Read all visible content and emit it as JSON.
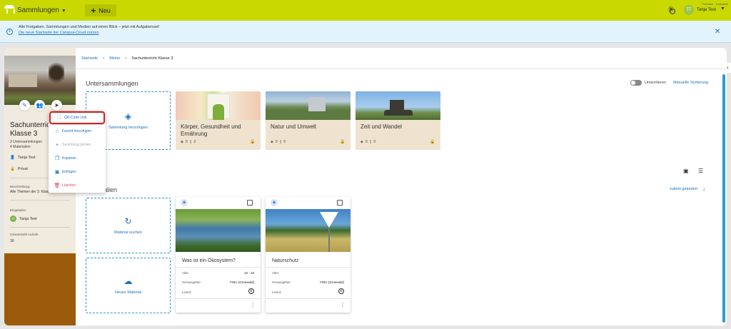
{
  "topbar": {
    "app_title": "Sammlungen",
    "new_label": "Neu",
    "user_org": "Premium · Demofeld",
    "user_initials": "TT",
    "user_name": "Tanja Test"
  },
  "banner": {
    "text": "Alle Freigaben, Sammlungen und Medien auf einen Blick – jetzt mit Aufgabenset!",
    "link": "Die neue Startseite der Campus-Cloud nutzen"
  },
  "breadcrumb": [
    "Startseite",
    "Meine",
    "Sachunterricht Klasse 3"
  ],
  "left_panel": {
    "title": "Sachunterricht Klasse 3",
    "subcollections": "3 Untersammlungen",
    "materials": "4 Materialien",
    "owner": "Tanja Test",
    "visibility": "Privat",
    "description_label": "Beschreibung",
    "description": "Alle Themen der 3. Klasse",
    "invited_label": "Eingeladen",
    "invited_initials": "TT",
    "invited_name": "Tanja Test",
    "views_label": "Gesamtzahl Aufrufe",
    "views": "30"
  },
  "context_menu": [
    {
      "icon": "⛶",
      "label": "QR-Code Link"
    },
    {
      "icon": "☆",
      "label": "Favorit hinzufügen"
    },
    {
      "icon": "✦",
      "label": "Sammlung pinnen"
    },
    {
      "icon": "❐",
      "label": "Kopieren"
    },
    {
      "icon": "▣",
      "label": "Einfügen"
    },
    {
      "icon": "🗑",
      "label": "Löschen"
    }
  ],
  "subcollections": {
    "title": "Untersammlungen",
    "sort_toggle_label": "Umsortieren",
    "sort_link": "Manuelle Sortierung",
    "add_label": "Sammlung hinzufügen",
    "cards": [
      {
        "title": "Körper, Gesundheit und Ernährung",
        "collections": "0",
        "materials": "2"
      },
      {
        "title": "Natur und Umwelt",
        "collections": "0",
        "materials": "0"
      },
      {
        "title": "Zeit und Wandel",
        "collections": "0",
        "materials": "0"
      }
    ]
  },
  "materials": {
    "title": "Materialien",
    "sort_link": "zuletzt geändert",
    "search_label": "Material suchen",
    "new_label": "Neues Material",
    "cards": [
      {
        "title": "Was ist ein Ökosystem?",
        "age_label": "Alter",
        "age": "10 - 18",
        "publisher_label": "Herausgeber",
        "publisher": "FWU (Grünwald)",
        "license_label": "Lizenz"
      },
      {
        "title": "Naturschutz",
        "age_label": "Alter",
        "age": "",
        "publisher_label": "Herausgeber",
        "publisher": "FWU (Grünwald)",
        "license_label": "Lizenz"
      }
    ]
  },
  "colors": {
    "topbar": "#c9d900",
    "accent": "#1a6fbf",
    "highlight": "#c62828",
    "left_panel_bottom": "#9b5a0c"
  }
}
